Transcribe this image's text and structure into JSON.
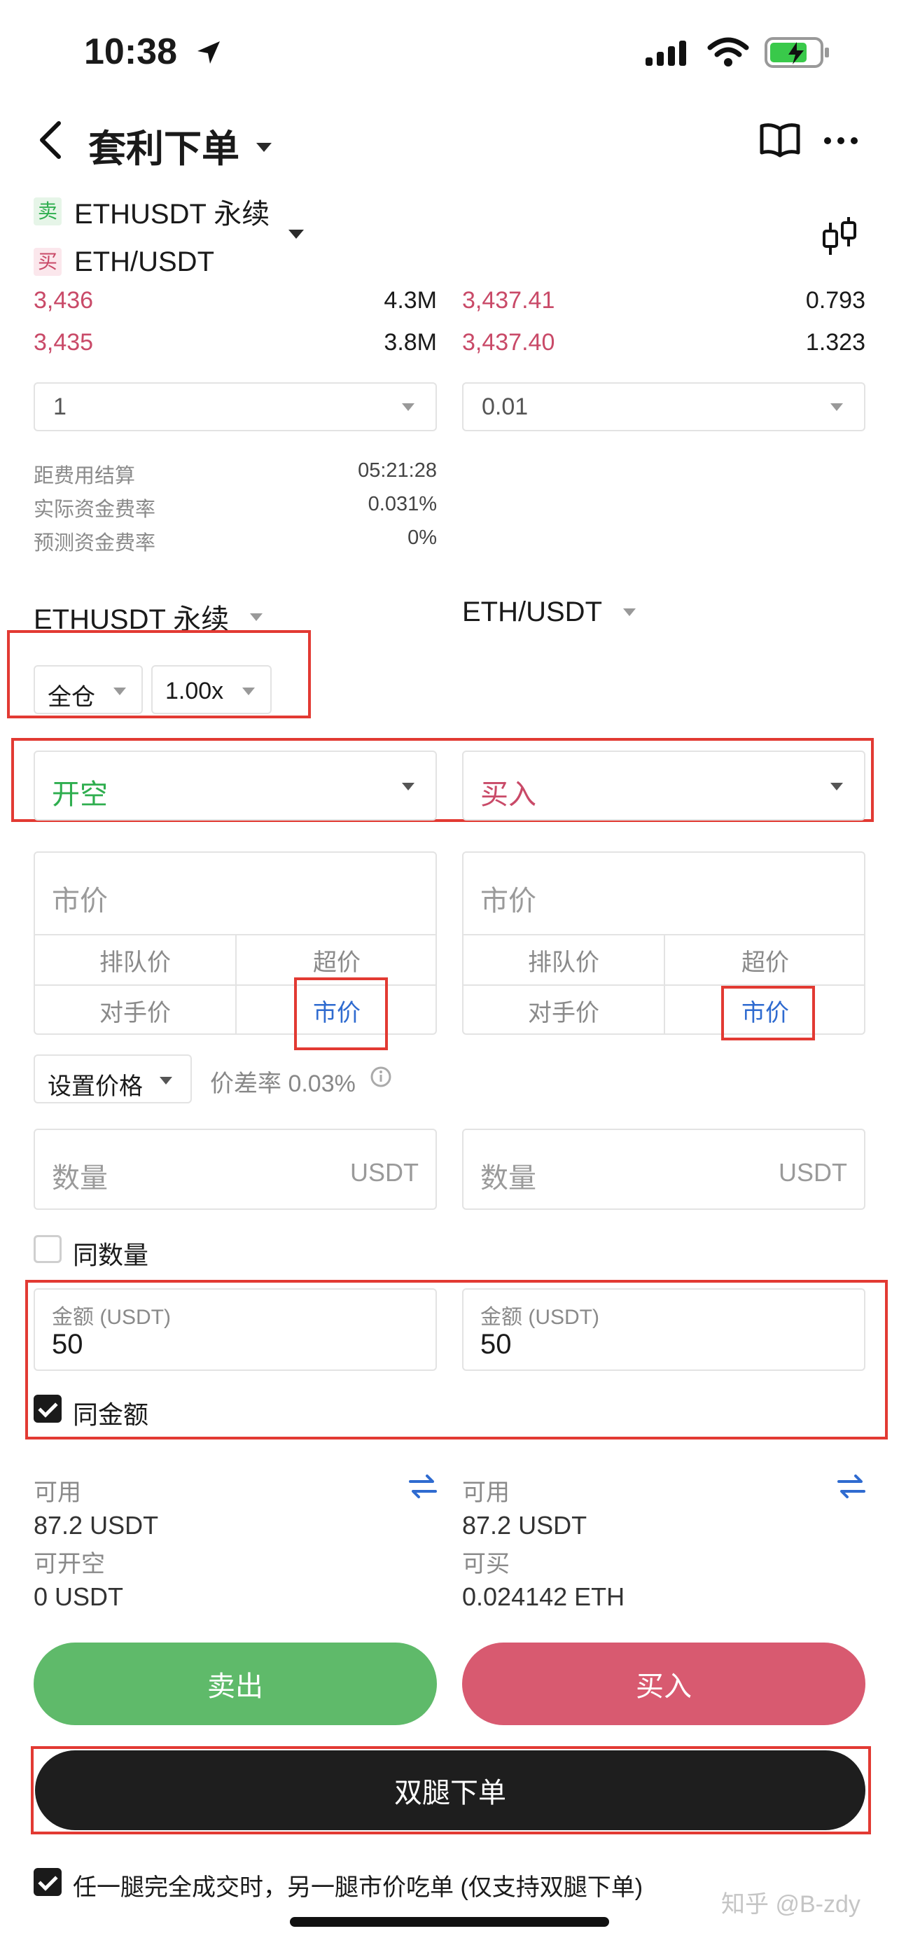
{
  "status_bar": {
    "time": "10:38"
  },
  "header": {
    "title": "套利下单"
  },
  "pair": {
    "leg1_tag": "卖",
    "leg1_name": "ETHUSDT 永续",
    "leg2_tag": "买",
    "leg2_name": "ETH/USDT"
  },
  "orderbook": {
    "left": [
      {
        "price": "3,436",
        "size": "4.3M"
      },
      {
        "price": "3,435",
        "size": "3.8M"
      }
    ],
    "right": [
      {
        "price": "3,437.41",
        "size": "0.793"
      },
      {
        "price": "3,437.40",
        "size": "1.323"
      }
    ]
  },
  "precision": {
    "left": "1",
    "right": "0.01"
  },
  "funding": [
    {
      "label": "距费用结算",
      "value": "05:21:28"
    },
    {
      "label": "实际资金费率",
      "value": "0.031%"
    },
    {
      "label": "预测资金费率",
      "value": "0%"
    }
  ],
  "legs": {
    "left_name": "ETHUSDT 永续",
    "right_name": "ETH/USDT",
    "margin_mode": "全仓",
    "leverage": "1.00x",
    "left_side": "开空",
    "right_side": "买入"
  },
  "price": {
    "left_placeholder": "市价",
    "right_placeholder": "市价",
    "options": [
      "排队价",
      "超价",
      "对手价",
      "市价"
    ],
    "set_price": "设置价格",
    "spread": "价差率 0.03%"
  },
  "quantity": {
    "placeholder": "数量",
    "unit": "USDT",
    "same_qty": "同数量"
  },
  "amount": {
    "label": "金额 (USDT)",
    "left_value": "50",
    "right_value": "50",
    "same_amount": "同金额"
  },
  "balance": {
    "left_avail_label": "可用",
    "left_avail": "87.2 USDT",
    "left_open_label": "可开空",
    "left_open": "0 USDT",
    "right_avail_label": "可用",
    "right_avail": "87.2 USDT",
    "right_open_label": "可买",
    "right_open": "0.024142 ETH"
  },
  "actions": {
    "sell": "卖出",
    "buy": "买入",
    "both": "双腿下单"
  },
  "footer": {
    "note": "任一腿完全成交时，另一腿市价吃单 (仅支持双腿下单)"
  },
  "watermark": "知乎 @B-zdy",
  "colors": {
    "buy_red": "#d85a70",
    "sell_green": "#5fba6a",
    "dark": "#1e1e1e",
    "accent_blue": "#2f6bd0"
  }
}
